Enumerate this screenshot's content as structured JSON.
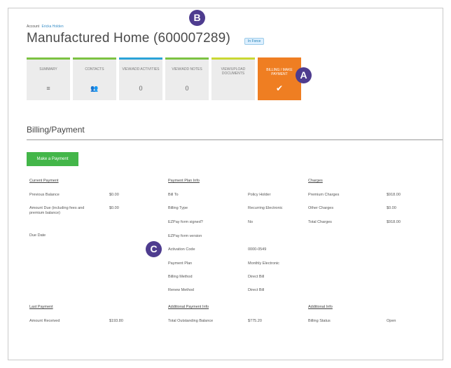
{
  "breadcrumb": {
    "prefix": "Account",
    "link": "Ericka Holden"
  },
  "title": "Manufactured Home (600007289)",
  "status_badge": "In Force",
  "tiles": [
    {
      "label": "Summary",
      "value": "≡",
      "color": "#7cc242"
    },
    {
      "label": "Contacts",
      "value": "👥",
      "color": "#7cc242"
    },
    {
      "label": "View/Add Activities",
      "value": "0",
      "color": "#2ba3d8"
    },
    {
      "label": "View/Add Notes",
      "value": "0",
      "color": "#7cc242"
    },
    {
      "label": "View/Upload Documents",
      "value": "",
      "color": "#c9d833"
    },
    {
      "label": "Billing / Make Payment",
      "value": "✔",
      "color": "#ef7e22",
      "active": true
    }
  ],
  "markers": {
    "a": "A",
    "b": "B",
    "c": "C"
  },
  "section_title": "Billing/Payment",
  "pay_button": "Make a Payment",
  "current_payment": {
    "heading": "Current Payment",
    "rows": [
      {
        "label": "Previous Balance",
        "value": "$0.00"
      },
      {
        "label": "Amount Due (including fees and premium balance)",
        "value": "$0.00"
      },
      {
        "label": "Due Date",
        "value": ""
      }
    ]
  },
  "payment_plan": {
    "heading": "Payment Plan Info",
    "rows": [
      {
        "label": "Bill To",
        "value": "Policy Holder"
      },
      {
        "label": "Billing Type",
        "value": "Recurring Electronic"
      },
      {
        "label": "EZPay form signed?",
        "value": "No"
      },
      {
        "label": "EZPay form version",
        "value": ""
      },
      {
        "label": "Activation Code",
        "value": "0000-0549"
      },
      {
        "label": "Payment Plan",
        "value": "Monthly Electronic"
      },
      {
        "label": "Billing Method",
        "value": "Direct Bill"
      },
      {
        "label": "Renew Method",
        "value": "Direct Bill"
      }
    ]
  },
  "charges": {
    "heading": "Charges",
    "rows": [
      {
        "label": "Premium Charges",
        "value": "$918.00"
      },
      {
        "label": "Other Charges",
        "value": "$0.00"
      },
      {
        "label": "Total Charges",
        "value": "$918.00"
      }
    ]
  },
  "last_payment": {
    "heading": "Last Payment",
    "rows": [
      {
        "label": "Amount Received",
        "value": "$193.80"
      }
    ]
  },
  "additional_payment": {
    "heading": "Additional Payment Info",
    "rows": [
      {
        "label": "Total Outstanding Balance",
        "value": "$775.20"
      }
    ]
  },
  "additional_info": {
    "heading": "Additional Info",
    "rows": [
      {
        "label": "Billing Status",
        "value": "Open"
      }
    ]
  }
}
